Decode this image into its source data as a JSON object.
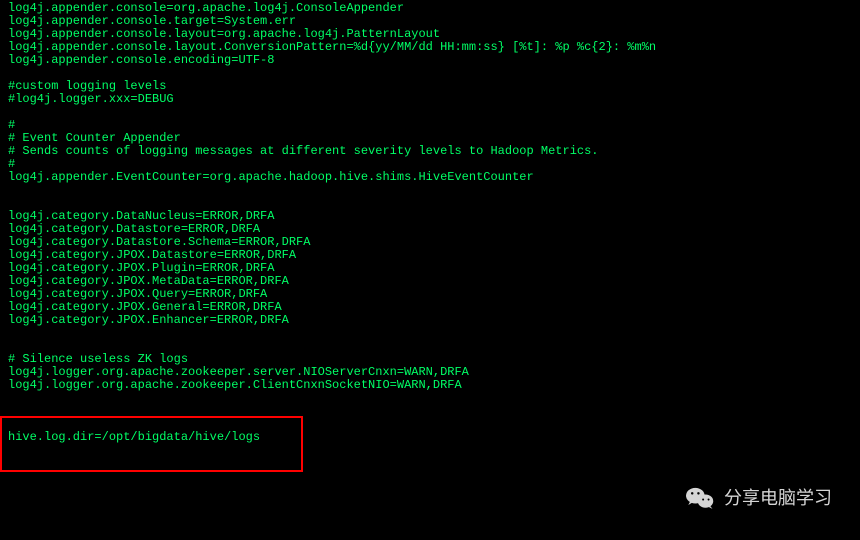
{
  "lines": [
    "log4j.appender.console=org.apache.log4j.ConsoleAppender",
    "log4j.appender.console.target=System.err",
    "log4j.appender.console.layout=org.apache.log4j.PatternLayout",
    "log4j.appender.console.layout.ConversionPattern=%d{yy/MM/dd HH:mm:ss} [%t]: %p %c{2}: %m%n",
    "log4j.appender.console.encoding=UTF-8",
    "",
    "#custom logging levels",
    "#log4j.logger.xxx=DEBUG",
    "",
    "#",
    "# Event Counter Appender",
    "# Sends counts of logging messages at different severity levels to Hadoop Metrics.",
    "#",
    "log4j.appender.EventCounter=org.apache.hadoop.hive.shims.HiveEventCounter",
    "",
    "",
    "log4j.category.DataNucleus=ERROR,DRFA",
    "log4j.category.Datastore=ERROR,DRFA",
    "log4j.category.Datastore.Schema=ERROR,DRFA",
    "log4j.category.JPOX.Datastore=ERROR,DRFA",
    "log4j.category.JPOX.Plugin=ERROR,DRFA",
    "log4j.category.JPOX.MetaData=ERROR,DRFA",
    "log4j.category.JPOX.Query=ERROR,DRFA",
    "log4j.category.JPOX.General=ERROR,DRFA",
    "log4j.category.JPOX.Enhancer=ERROR,DRFA",
    "",
    "",
    "# Silence useless ZK logs",
    "log4j.logger.org.apache.zookeeper.server.NIOServerCnxn=WARN,DRFA",
    "log4j.logger.org.apache.zookeeper.ClientCnxnSocketNIO=WARN,DRFA",
    "",
    "",
    "",
    "hive.log.dir=/opt/bigdata/hive/logs"
  ],
  "watermark_text": "分享电脑学习"
}
